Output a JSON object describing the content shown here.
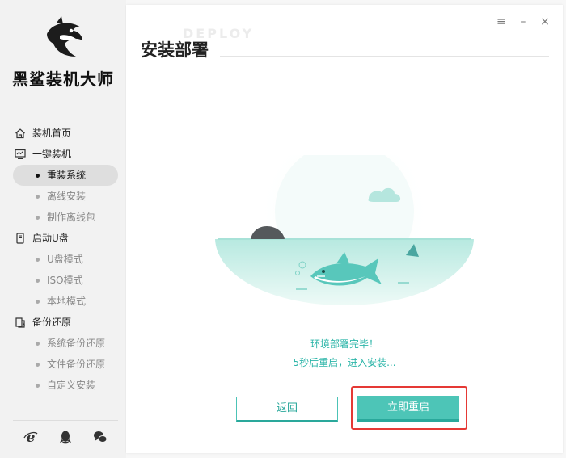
{
  "app": {
    "brand": "黑鲨装机大师",
    "ghost_text": "DEPLOY"
  },
  "colors": {
    "accent": "#4dc5b7",
    "accent_dark": "#2aa89b",
    "highlight": "#e53935"
  },
  "window_controls": [
    {
      "icon": "menu-icon",
      "glyph": "≡"
    },
    {
      "icon": "minimize-icon",
      "glyph": "–"
    },
    {
      "icon": "close-icon",
      "glyph": "×"
    }
  ],
  "nav": {
    "home": "装机首页",
    "one_click": "一键装机",
    "reinstall": "重装系统",
    "offline_install": "离线安装",
    "make_offline_pkg": "制作离线包",
    "boot_u": "启动U盘",
    "u_mode": "U盘模式",
    "iso_mode": "ISO模式",
    "local_mode": "本地模式",
    "backup_restore": "备份还原",
    "sys_backup": "系统备份还原",
    "file_backup": "文件备份还原",
    "custom_install": "自定义安装"
  },
  "main": {
    "title": "安装部署",
    "message_done": "环境部署完毕！",
    "message_countdown": "5秒后重启，进入安装..."
  },
  "buttons": {
    "back": "返回",
    "restart_now": "立即重启"
  },
  "bottom_icons": [
    "ie-icon",
    "qq-icon",
    "wechat-icon"
  ]
}
